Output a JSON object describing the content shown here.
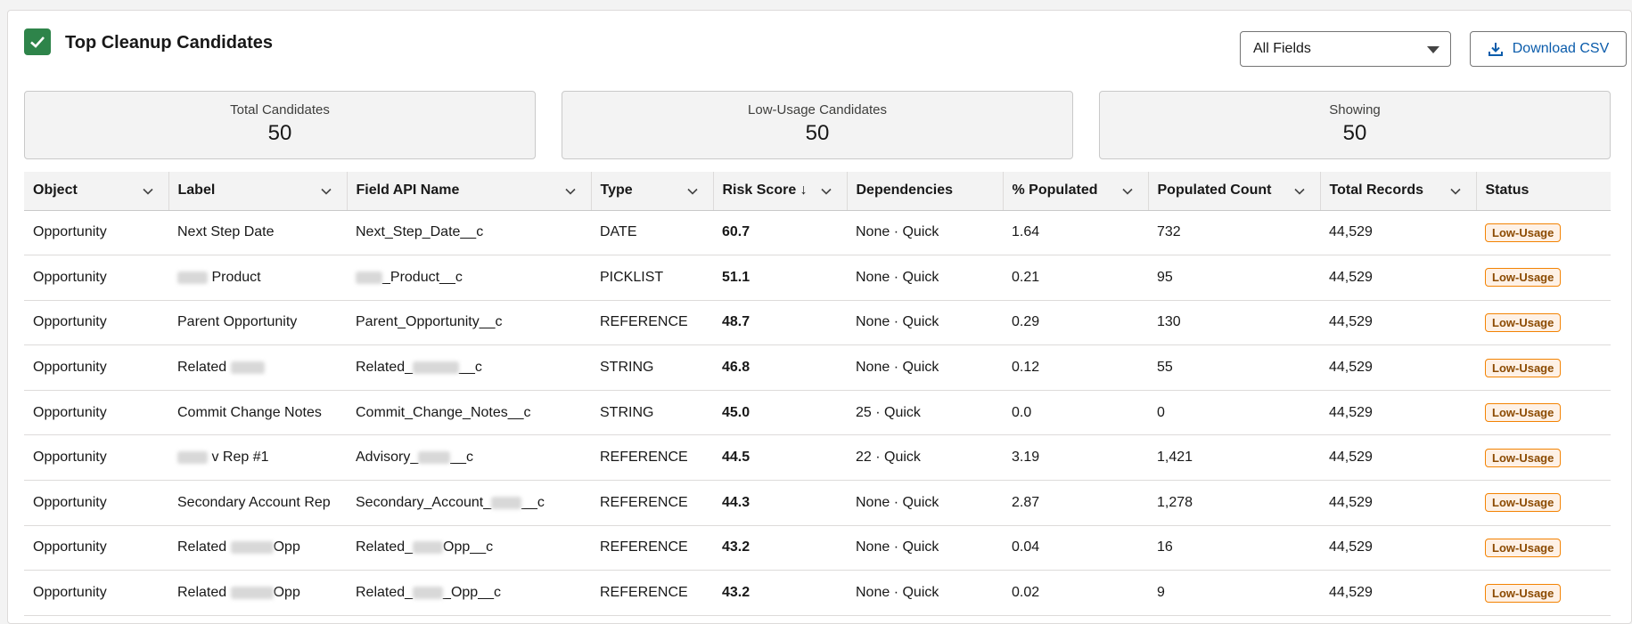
{
  "header": {
    "title": "Top Cleanup Candidates",
    "filter_value": "All Fields",
    "download_label": "Download CSV"
  },
  "stats": [
    {
      "label": "Total Candidates",
      "value": "50"
    },
    {
      "label": "Low-Usage Candidates",
      "value": "50"
    },
    {
      "label": "Showing",
      "value": "50"
    }
  ],
  "table": {
    "columns": [
      "Object",
      "Label",
      "Field API Name",
      "Type",
      "Risk Score ↓",
      "Dependencies",
      "% Populated",
      "Populated Count",
      "Total Records",
      "Status"
    ],
    "rows": [
      {
        "object": "Opportunity",
        "label": "Next Step Date",
        "api": "Next_Step_Date__c",
        "type": "DATE",
        "risk": "60.7",
        "deps": "None · Quick",
        "pct": "1.64",
        "count": "732",
        "total": "44,529",
        "status": "Low-Usage"
      },
      {
        "object": "Opportunity",
        "label": "Product",
        "api": "_Product__c",
        "type": "PICKLIST",
        "risk": "51.1",
        "deps": "None · Quick",
        "pct": "0.21",
        "count": "95",
        "total": "44,529",
        "status": "Low-Usage"
      },
      {
        "object": "Opportunity",
        "label": "Parent Opportunity",
        "api": "Parent_Opportunity__c",
        "type": "REFERENCE",
        "risk": "48.7",
        "deps": "None · Quick",
        "pct": "0.29",
        "count": "130",
        "total": "44,529",
        "status": "Low-Usage"
      },
      {
        "object": "Opportunity",
        "label": "Related",
        "api": "Related_",
        "type": "STRING",
        "risk": "46.8",
        "deps": "None · Quick",
        "pct": "0.12",
        "count": "55",
        "total": "44,529",
        "status": "Low-Usage"
      },
      {
        "object": "Opportunity",
        "label": "Commit Change Notes",
        "api": "Commit_Change_Notes__c",
        "type": "STRING",
        "risk": "45.0",
        "deps": "25 · Quick",
        "pct": "0.0",
        "count": "0",
        "total": "44,529",
        "status": "Low-Usage"
      },
      {
        "object": "Opportunity",
        "label": "v Rep #1",
        "api": "Advisory_",
        "type": "REFERENCE",
        "risk": "44.5",
        "deps": "22 · Quick",
        "pct": "3.19",
        "count": "1,421",
        "total": "44,529",
        "status": "Low-Usage"
      },
      {
        "object": "Opportunity",
        "label": "Secondary Account Rep",
        "api": "Secondary_Account_",
        "type": "REFERENCE",
        "risk": "44.3",
        "deps": "None · Quick",
        "pct": "2.87",
        "count": "1,278",
        "total": "44,529",
        "status": "Low-Usage"
      },
      {
        "object": "Opportunity",
        "label": "Related",
        "api": "Related_",
        "type": "REFERENCE",
        "risk": "43.2",
        "deps": "None · Quick",
        "pct": "0.04",
        "count": "16",
        "total": "44,529",
        "status": "Low-Usage"
      },
      {
        "object": "Opportunity",
        "label": "Related",
        "api": "Related_",
        "type": "REFERENCE",
        "risk": "43.2",
        "deps": "None · Quick",
        "pct": "0.02",
        "count": "9",
        "total": "44,529",
        "status": "Low-Usage"
      }
    ],
    "label_suffix": [
      "",
      "",
      "",
      "",
      "",
      "",
      "",
      "Opp",
      "Opp"
    ],
    "api_suffix": [
      "",
      "",
      "",
      "__c",
      "",
      "__c",
      "__c",
      "Opp__c",
      "_Opp__c"
    ]
  },
  "colors": {
    "accent": "#2e844a",
    "link": "#0b5cab",
    "risk": "#ba0517",
    "badge_border": "#f38303"
  }
}
